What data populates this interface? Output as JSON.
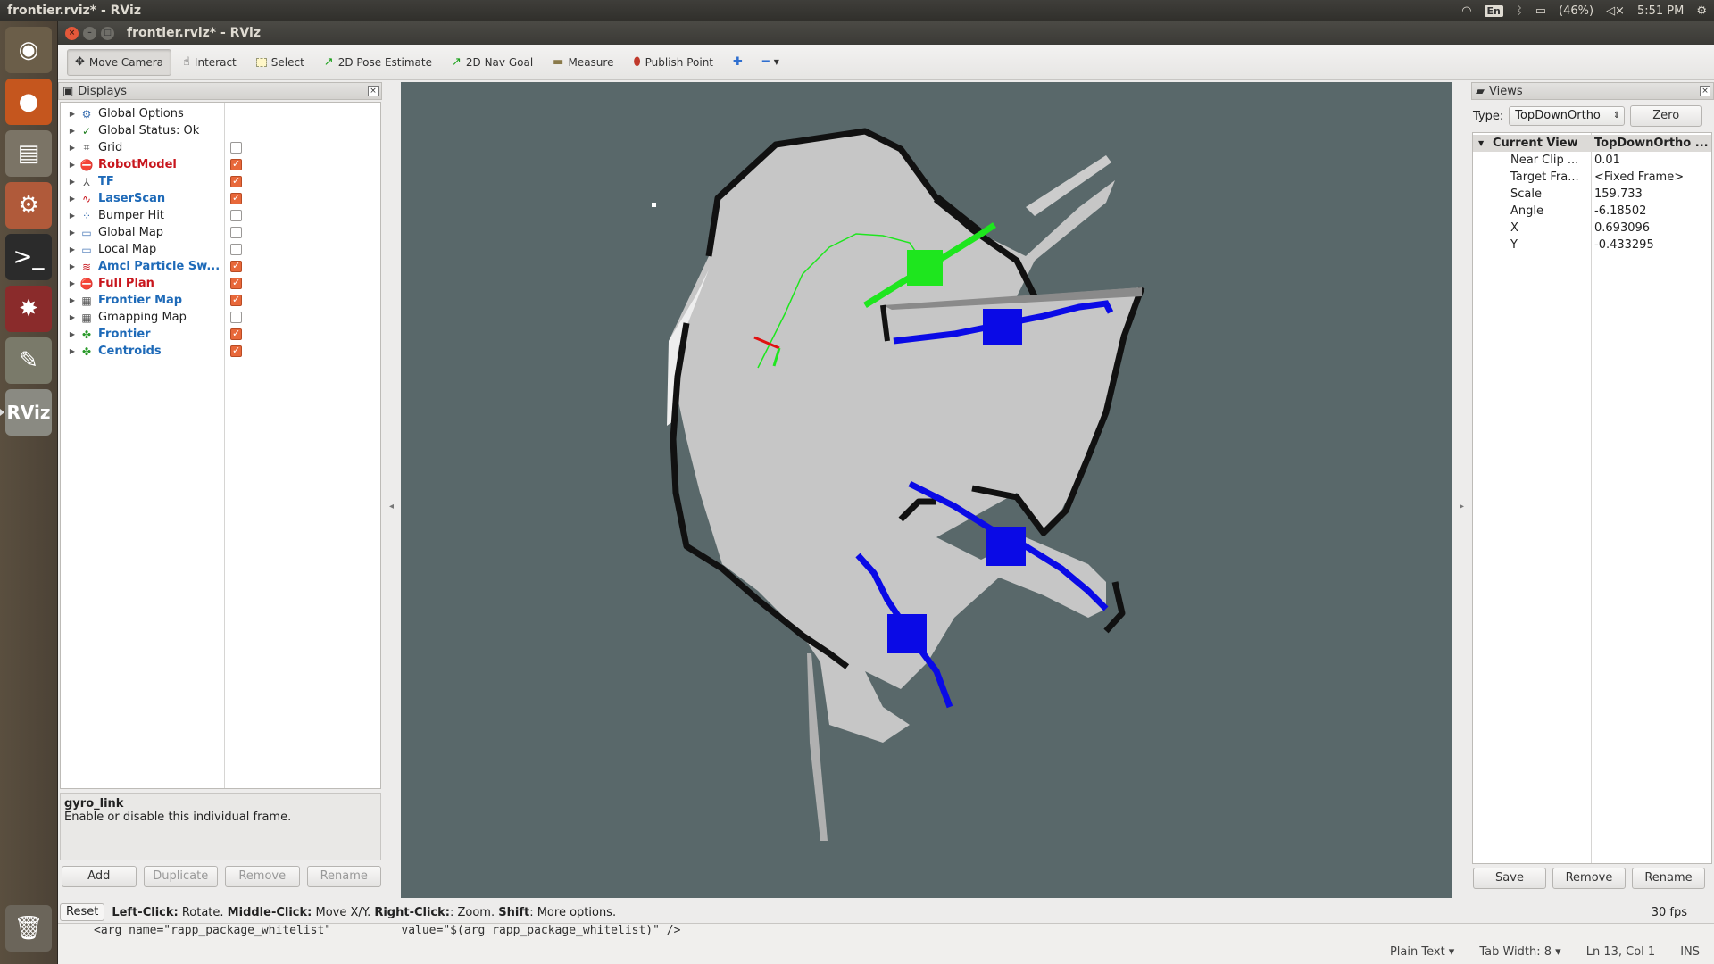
{
  "system": {
    "window_title": "frontier.rviz* - RViz",
    "language": "En",
    "battery": "(46%)",
    "clock": "5:51 PM"
  },
  "window": {
    "title": "frontier.rviz* - RViz"
  },
  "toolbar": {
    "tools": [
      {
        "label": "Move Camera",
        "icon": "move-camera-icon",
        "active": true
      },
      {
        "label": "Interact",
        "icon": "hand-icon",
        "active": false
      },
      {
        "label": "Select",
        "icon": "select-box-icon",
        "active": false
      },
      {
        "label": "2D Pose Estimate",
        "icon": "green-arrow-icon",
        "active": false
      },
      {
        "label": "2D Nav Goal",
        "icon": "green-arrow-icon",
        "active": false
      },
      {
        "label": "Measure",
        "icon": "ruler-icon",
        "active": false
      },
      {
        "label": "Publish Point",
        "icon": "map-pin-icon",
        "active": false
      }
    ]
  },
  "displays": {
    "title": "Displays",
    "items": [
      {
        "label": "Global Options",
        "style": "normal",
        "checkbox": null
      },
      {
        "label": "Global Status: Ok",
        "style": "normal",
        "checkbox": null
      },
      {
        "label": "Grid",
        "style": "normal",
        "checkbox": false
      },
      {
        "label": "RobotModel",
        "style": "red",
        "checkbox": true
      },
      {
        "label": "TF",
        "style": "blue",
        "checkbox": true
      },
      {
        "label": "LaserScan",
        "style": "blue",
        "checkbox": true
      },
      {
        "label": "Bumper Hit",
        "style": "normal",
        "checkbox": false
      },
      {
        "label": "Global Map",
        "style": "normal",
        "checkbox": false
      },
      {
        "label": "Local Map",
        "style": "normal",
        "checkbox": false
      },
      {
        "label": "Amcl Particle Sw...",
        "style": "blue",
        "checkbox": true
      },
      {
        "label": "Full Plan",
        "style": "red",
        "checkbox": true
      },
      {
        "label": "Frontier Map",
        "style": "blue",
        "checkbox": true
      },
      {
        "label": "Gmapping Map",
        "style": "normal",
        "checkbox": false
      },
      {
        "label": "Frontier",
        "style": "blue",
        "checkbox": true
      },
      {
        "label": "Centroids",
        "style": "blue",
        "checkbox": true
      }
    ],
    "description_title": "gyro_link",
    "description_text": "Enable or disable this individual frame.",
    "buttons": {
      "add": "Add",
      "duplicate": "Duplicate",
      "remove": "Remove",
      "rename": "Rename"
    }
  },
  "views": {
    "title": "Views",
    "type_label": "Type:",
    "type_value": "TopDownOrtho",
    "zero_label": "Zero",
    "current_view_label": "Current View",
    "current_view_value": "TopDownOrtho ...",
    "properties": [
      {
        "key": "Near Clip ...",
        "value": "0.01"
      },
      {
        "key": "Target Fra...",
        "value": "<Fixed Frame>"
      },
      {
        "key": "Scale",
        "value": "159.733"
      },
      {
        "key": "Angle",
        "value": "-6.18502"
      },
      {
        "key": "X",
        "value": "0.693096"
      },
      {
        "key": "Y",
        "value": "-0.433295"
      }
    ],
    "buttons": {
      "save": "Save",
      "remove": "Remove",
      "rename": "Rename"
    }
  },
  "status": {
    "reset": "Reset",
    "help_left": "Left-Click:",
    "help_left_txt": " Rotate. ",
    "help_mid": "Middle-Click:",
    "help_mid_txt": " Move X/Y. ",
    "help_right": "Right-Click:",
    "help_right_txt": ": Zoom. ",
    "help_shift": "Shift",
    "help_shift_txt": ": More options.",
    "fps": "30 fps"
  },
  "editor": {
    "code_line": "<arg name=\"rapp_package_whitelist\"          value=\"$(arg rapp_package_whitelist)\" />",
    "language": "Plain Text",
    "tab_width": "Tab Width: 8",
    "position": "Ln 13, Col 1",
    "mode": "INS"
  },
  "colors": {
    "map_background": "#59686a",
    "free_space": "#c6c6c6",
    "obstacle": "#111111",
    "frontier": "#0a0ae6",
    "plan": "#1ee61e",
    "robot_x_axis": "#e01010"
  }
}
